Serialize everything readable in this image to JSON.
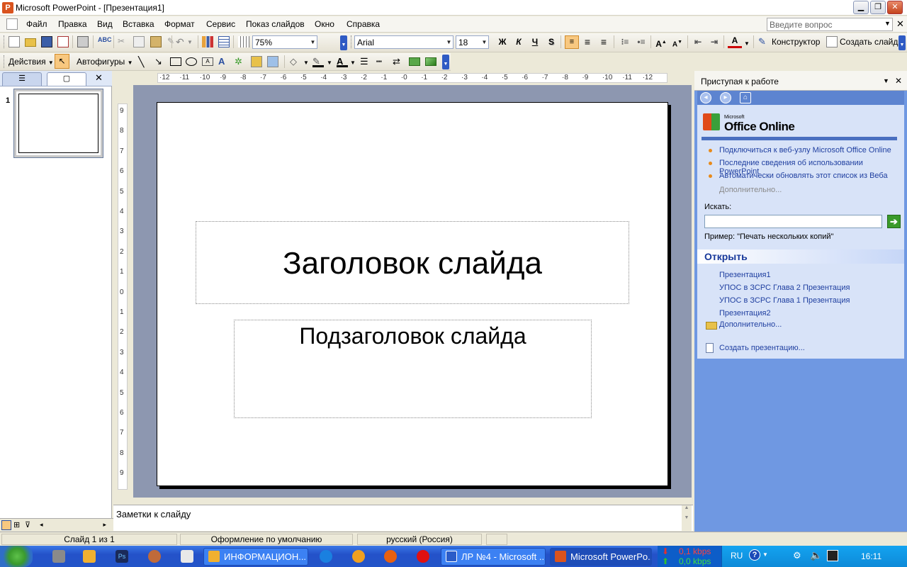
{
  "window": {
    "title": "Microsoft PowerPoint - [Презентация1]",
    "app_icon": "P"
  },
  "menu": {
    "items": [
      "Файл",
      "Правка",
      "Вид",
      "Вставка",
      "Формат",
      "Сервис",
      "Показ слайдов",
      "Окно",
      "Справка"
    ],
    "ask_placeholder": "Введите вопрос"
  },
  "toolbar": {
    "zoom": "75%",
    "font": "Arial",
    "size": "18",
    "bold": "Ж",
    "italic": "К",
    "underline": "Ч",
    "shadow": "S",
    "designer": "Конструктор",
    "new_slide": "Создать слайд"
  },
  "drawing": {
    "actions": "Действия",
    "autoshapes": "Автофигуры"
  },
  "ruler": {
    "h": [
      "12",
      "11",
      "10",
      "9",
      "8",
      "7",
      "6",
      "5",
      "4",
      "3",
      "2",
      "1",
      "0",
      "1",
      "2",
      "3",
      "4",
      "5",
      "6",
      "7",
      "8",
      "9",
      "10",
      "11",
      "12"
    ],
    "v": [
      "9",
      "8",
      "7",
      "6",
      "5",
      "4",
      "3",
      "2",
      "1",
      "0",
      "1",
      "2",
      "3",
      "4",
      "5",
      "6",
      "7",
      "8",
      "9"
    ]
  },
  "slides_pane": {
    "slide_number": "1"
  },
  "slide": {
    "title": "Заголовок слайда",
    "subtitle": "Подзаголовок слайда"
  },
  "notes": {
    "placeholder": "Заметки к слайду"
  },
  "task_pane": {
    "title": "Приступая к работе",
    "logo_small": "Microsoft",
    "logo": "Office Online",
    "links": [
      "Подключиться к веб-узлу Microsoft Office Online",
      "Последние сведения об использовании PowerPoint",
      "Автоматически обновлять этот список из Веба"
    ],
    "more": "Дополнительно...",
    "search_label": "Искать:",
    "example": "Пример:  \"Печать нескольких копий\"",
    "open_header": "Открыть",
    "open_items": [
      "Презентация1",
      "УПОС в ЗСРС Глава 2 Презентация",
      "УПОС в ЗСРС Глава 1 Презентация",
      "Презентация2"
    ],
    "open_more": "Дополнительно...",
    "create": "Создать презентацию..."
  },
  "status": {
    "slide": "Слайд 1 из 1",
    "design": "Оформление по умолчанию",
    "language": "русский (Россия)"
  },
  "taskbar": {
    "buttons": [
      "ИНФОРМАЦИОН...",
      "ЛР №4 - Microsoft ...",
      "Microsoft PowerPo..."
    ],
    "net_down": "0,1 kbps",
    "net_up": "0,0 kbps",
    "lang": "RU",
    "clock": "16:11"
  }
}
